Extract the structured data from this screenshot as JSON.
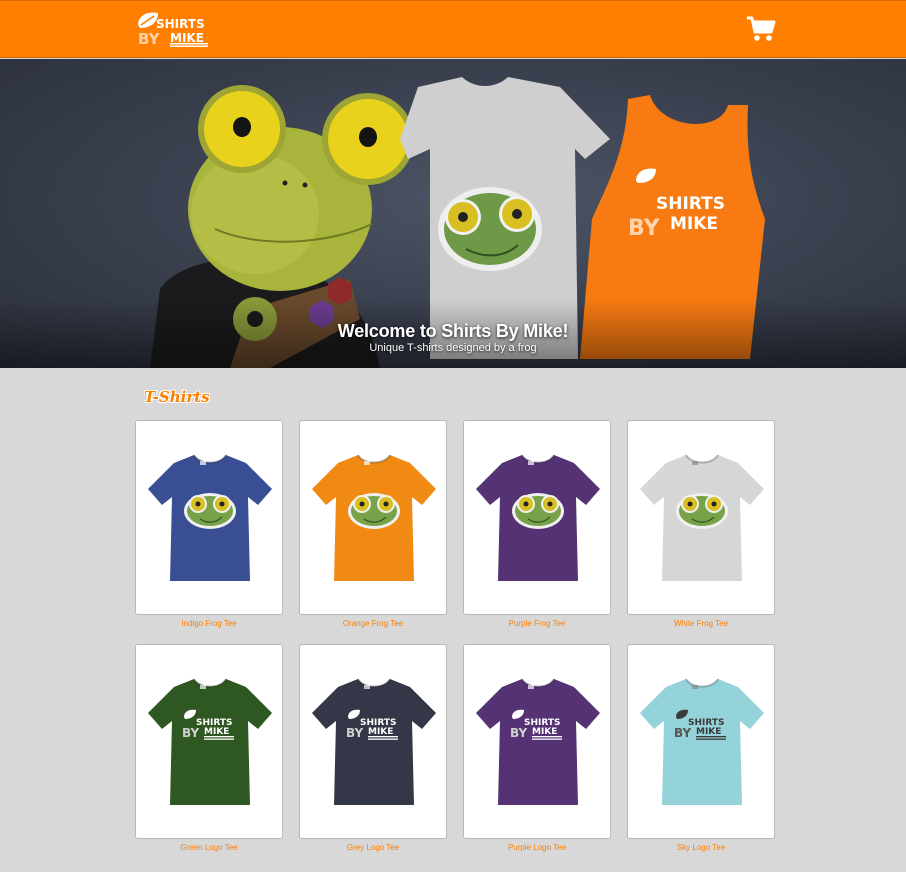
{
  "header": {
    "logo_line1": "SHIRTS",
    "logo_line2_a": "BY",
    "logo_line2_b": "MIKE",
    "cart_icon": "shopping-cart-icon",
    "brand_color": "#ff7f00"
  },
  "hero": {
    "title": "Welcome to Shirts By Mike!",
    "subtitle": "Unique T-shirts designed by a frog",
    "tank_logo_line1": "SHIRTS",
    "tank_logo_line2_a": "BY",
    "tank_logo_line2_b": "MIKE"
  },
  "section": {
    "title": "T-Shirts"
  },
  "products": [
    {
      "name": "Indigo Frog Tee",
      "color": "#3a4f93",
      "graphic": "frog"
    },
    {
      "name": "Orange Frog Tee",
      "color": "#f08a12",
      "graphic": "frog"
    },
    {
      "name": "Purple Frog Tee",
      "color": "#553274",
      "graphic": "frog"
    },
    {
      "name": "White Frog Tee",
      "color": "#d6d6d6",
      "graphic": "frog"
    },
    {
      "name": "Green Logo Tee",
      "color": "#2f5721",
      "graphic": "logo"
    },
    {
      "name": "Grey Logo Tee",
      "color": "#343747",
      "graphic": "logo"
    },
    {
      "name": "Purple Logo Tee",
      "color": "#553274",
      "graphic": "logo"
    },
    {
      "name": "Sky Logo Tee",
      "color": "#93d3d9",
      "graphic": "logo"
    }
  ]
}
